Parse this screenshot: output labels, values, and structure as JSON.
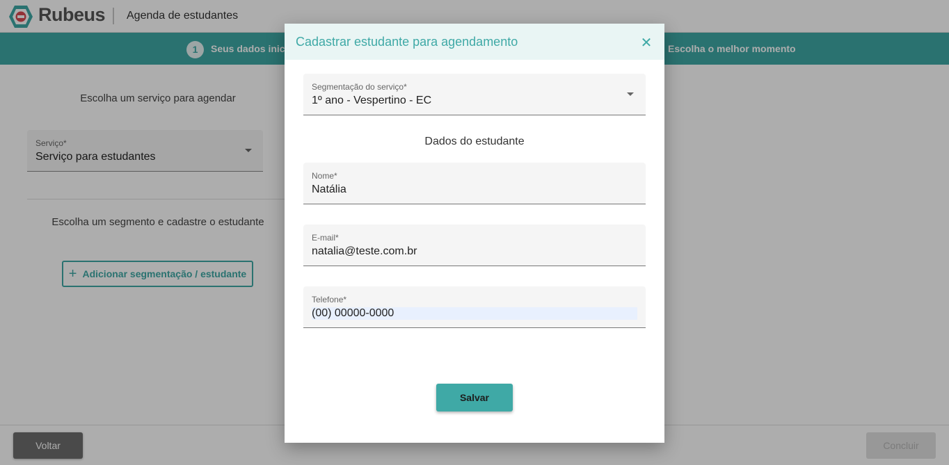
{
  "header": {
    "brand": "Rubeus",
    "app_title": "Agenda de estudantes"
  },
  "stepper": {
    "step1_number": "1",
    "step1_label": "Seus dados iniciais",
    "step3_label": "Escolha o melhor momento"
  },
  "main": {
    "service_section_title": "Escolha um serviço para agendar",
    "service_field_label": "Serviço*",
    "service_field_value": "Serviço para estudantes",
    "segment_section_title": "Escolha um segmento e cadastre o estudante",
    "add_button_label": "Adicionar segmentação / estudante"
  },
  "footer": {
    "back_label": "Voltar",
    "finish_label": "Concluir"
  },
  "dialog": {
    "title": "Cadastrar estudante para agendamento",
    "close_icon": "close-icon",
    "segment_label": "Segmentação do serviço*",
    "segment_value": "1º ano - Vespertino - EC",
    "student_section_title": "Dados do estudante",
    "name_label": "Nome*",
    "name_value": "Natália",
    "email_label": "E-mail*",
    "email_value": "natalia@teste.com.br",
    "phone_label": "Telefone*",
    "phone_value": "(00) 00000-0000",
    "save_label": "Salvar"
  },
  "colors": {
    "accent": "#3fa9a6",
    "header_bg": "#e9f5f4"
  }
}
